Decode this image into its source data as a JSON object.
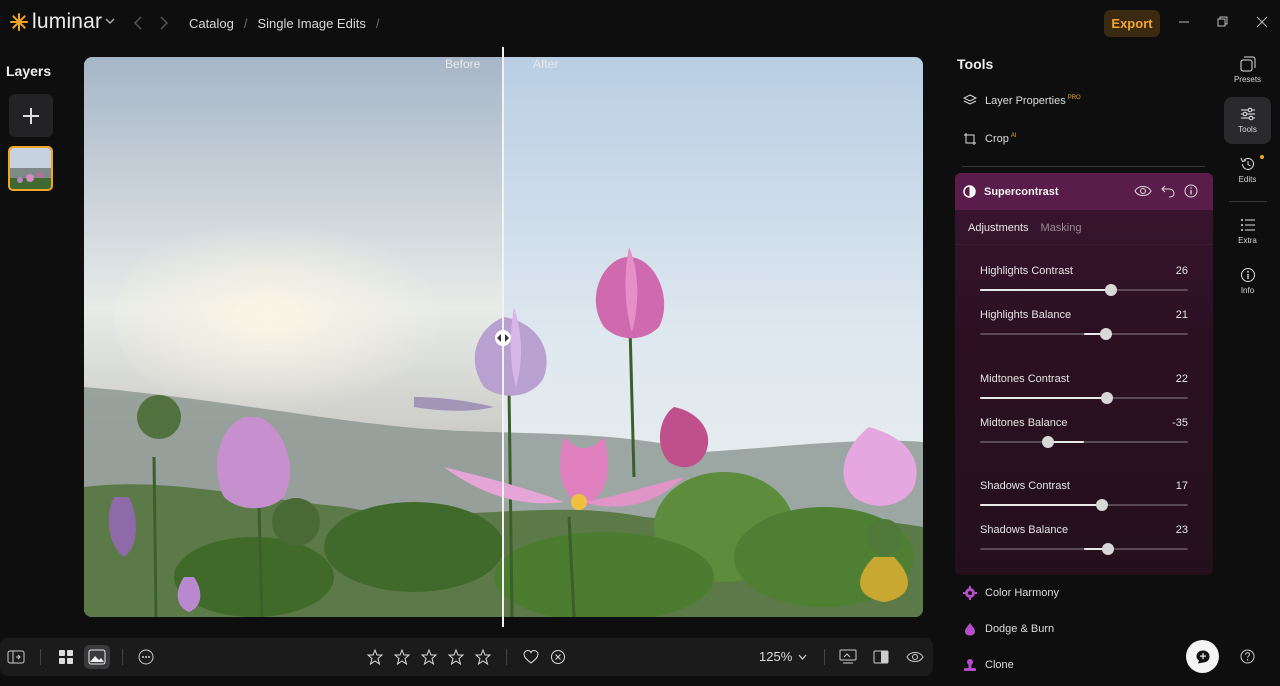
{
  "app": {
    "logo_text": "luminar",
    "accent": "#f0a428"
  },
  "breadcrumb": [
    "Catalog",
    "Single Image Edits"
  ],
  "header": {
    "export_label": "Export"
  },
  "layers": {
    "title": "Layers"
  },
  "canvas": {
    "before_label": "Before",
    "after_label": "After"
  },
  "zoom": {
    "value": "125%"
  },
  "tools": {
    "title": "Tools",
    "top_items": [
      {
        "label": "Layer Properties",
        "badge": "PRO",
        "icon": "layers-icon"
      },
      {
        "label": "Crop",
        "badge": "AI",
        "icon": "crop-icon"
      }
    ],
    "supercontrast": {
      "title": "Supercontrast",
      "tabs": [
        "Adjustments",
        "Masking"
      ],
      "sliders": [
        {
          "label": "Highlights Contrast",
          "value": 26
        },
        {
          "label": "Highlights Balance",
          "value": 21
        },
        {
          "label": "Midtones Contrast",
          "value": 22
        },
        {
          "label": "Midtones Balance",
          "value": -35
        },
        {
          "label": "Shadows Contrast",
          "value": 17
        },
        {
          "label": "Shadows Balance",
          "value": 23
        }
      ]
    },
    "bottom_items": [
      {
        "label": "Color Harmony",
        "icon": "color-harmony-icon"
      },
      {
        "label": "Dodge & Burn",
        "icon": "dodge-burn-icon"
      },
      {
        "label": "Clone",
        "icon": "clone-stamp-icon"
      }
    ]
  },
  "rail": [
    {
      "label": "Presets",
      "icon": "presets-icon"
    },
    {
      "label": "Tools",
      "icon": "sliders-icon"
    },
    {
      "label": "Edits",
      "icon": "history-icon"
    },
    {
      "label": "Extra",
      "icon": "list-icon"
    },
    {
      "label": "Info",
      "icon": "info-icon"
    }
  ]
}
